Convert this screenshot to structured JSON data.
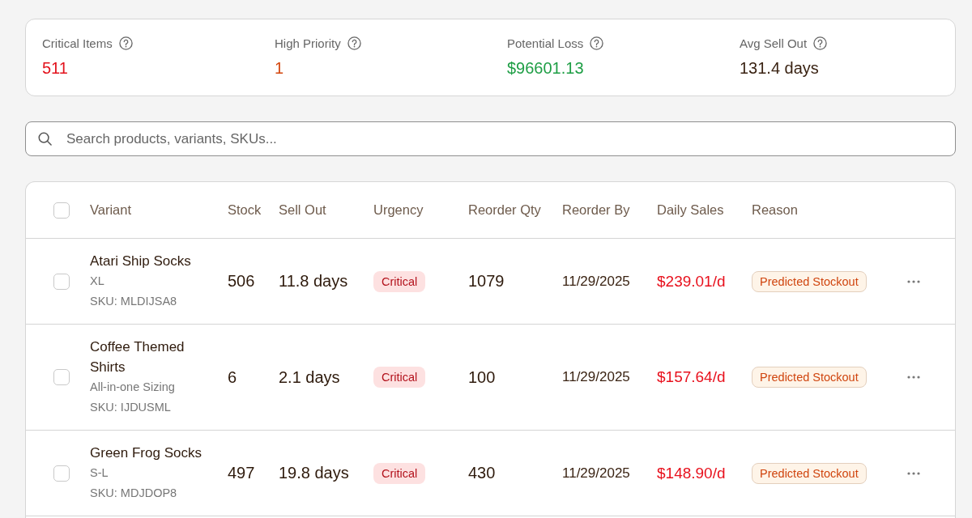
{
  "stats": [
    {
      "label": "Critical Items",
      "value": "511",
      "color": "#e3121c"
    },
    {
      "label": "High Priority",
      "value": "1",
      "color": "#d4470e"
    },
    {
      "label": "Potential Loss",
      "value": "$96601.13",
      "color": "#1e9e45"
    },
    {
      "label": "Avg Sell Out",
      "value": "131.4 days",
      "color": "#3a2313"
    }
  ],
  "search": {
    "placeholder": "Search products, variants, SKUs..."
  },
  "table": {
    "select_all_checked": false,
    "columns": [
      "Variant",
      "Stock",
      "Sell Out",
      "Urgency",
      "Reorder Qty",
      "Reorder By",
      "Daily Sales",
      "Reason"
    ],
    "rows": [
      {
        "checked": false,
        "name": "Atari Ship Socks",
        "option": "XL",
        "sku": "SKU: MLDIJSA8",
        "stock": "506",
        "sell_out": "11.8 days",
        "urgency": "Critical",
        "reorder_qty": "1079",
        "reorder_by": "11/29/2025",
        "daily_sales": "$239.01/d",
        "reason": "Predicted Stockout"
      },
      {
        "checked": false,
        "name": "Coffee Themed Shirts",
        "option": "All-in-one Sizing",
        "sku": "SKU: IJDUSML",
        "stock": "6",
        "sell_out": "2.1 days",
        "urgency": "Critical",
        "reorder_qty": "100",
        "reorder_by": "11/29/2025",
        "daily_sales": "$157.64/d",
        "reason": "Predicted Stockout"
      },
      {
        "checked": false,
        "name": "Green Frog Socks",
        "option": "S-L",
        "sku": "SKU: MDJDOP8",
        "stock": "497",
        "sell_out": "19.8 days",
        "urgency": "Critical",
        "reorder_qty": "430",
        "reorder_by": "11/29/2025",
        "daily_sales": "$148.90/d",
        "reason": "Predicted Stockout"
      }
    ]
  }
}
